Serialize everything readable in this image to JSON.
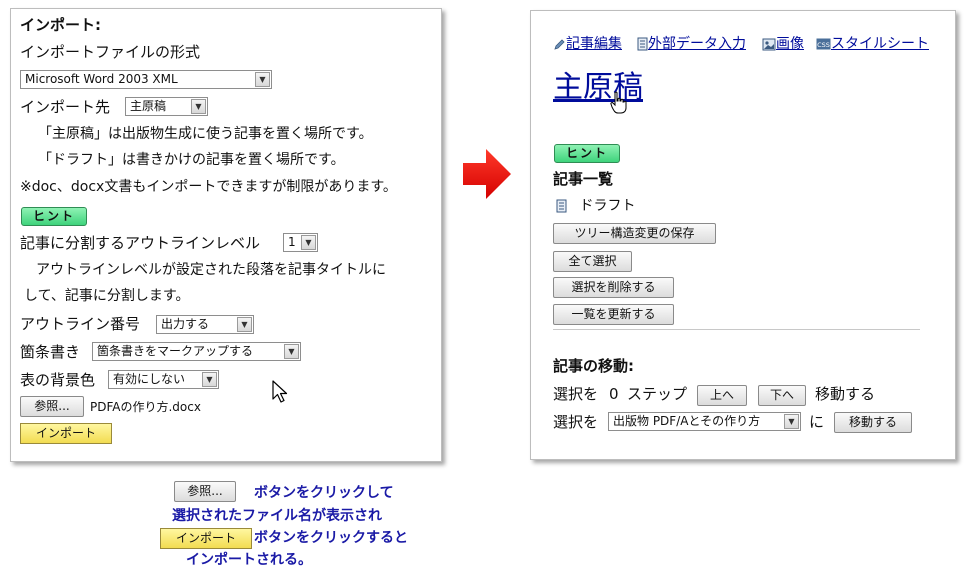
{
  "import_panel": {
    "heading": "インポート:",
    "format_label": "インポートファイルの形式",
    "format_value": "Microsoft Word 2003 XML",
    "dest_label": "インポート先",
    "dest_value": "主原稿",
    "dest_note1": "「主原稿」は出版物生成に使う記事を置く場所です。",
    "dest_note2": "「ドラフト」は書きかけの記事を置く場所です。",
    "doc_note": "※doc、docx文書もインポートできますが制限があります。",
    "hint_label": "ヒント",
    "outline_label": "記事に分割するアウトラインレベル",
    "outline_value": "1",
    "outline_note1": "アウトラインレベルが設定された段落を記事タイトルに",
    "outline_note2": "して、記事に分割します。",
    "numbering_label": "アウトライン番号",
    "numbering_value": "出力する",
    "bullet_label": "箇条書き",
    "bullet_value": "箇条書きをマークアップする",
    "tablebg_label": "表の背景色",
    "tablebg_value": "有効にしない",
    "browse_label": "参照...",
    "file_name": "PDFAの作り方.docx",
    "import_label": "インポート"
  },
  "article_panel": {
    "nav": {
      "edit": "記事編集",
      "external": "外部データ入力",
      "image": "画像",
      "stylesheet": "スタイルシート"
    },
    "title": "主原稿",
    "hint_label": "ヒント",
    "list_heading": "記事一覧",
    "draft_label": "ドラフト",
    "buttons": {
      "save_tree": "ツリー構造変更の保存",
      "select_all": "全て選択",
      "delete_selected": "選択を削除する",
      "refresh": "一覧を更新する"
    },
    "move": {
      "heading": "記事の移動:",
      "select_prefix": "選択を",
      "steps": "0",
      "steps_suffix": "ステップ",
      "up": "上へ",
      "down": "下へ",
      "move_text": "移動する",
      "select_prefix2": "選択を",
      "target_value": "出版物 PDF/Aとその作り方",
      "to": "に",
      "move_button": "移動する"
    }
  },
  "caption": {
    "browse_label": "参照...",
    "line1": "ボタンをクリックして",
    "line2": "選択されたファイル名が表示され",
    "import_label": "インポート",
    "line3": "ボタンをクリックすると",
    "line4": "インポートされる。"
  },
  "colors": {
    "arrow": "#e60000",
    "hint": "#4fd98a",
    "import_button": "#f5e264",
    "link": "#000c9b",
    "caption_text": "#1a1aa6"
  }
}
